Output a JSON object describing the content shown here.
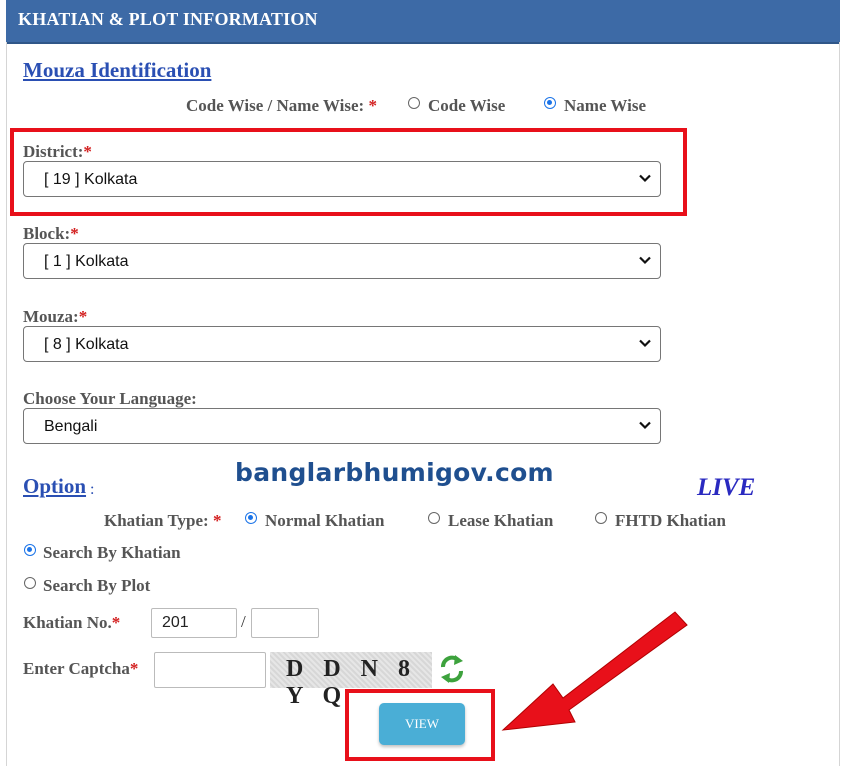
{
  "header": {
    "title": "KHATIAN & PLOT INFORMATION"
  },
  "mouza_section": {
    "title": "Mouza Identification",
    "mode_label": "Code Wise / Name Wise:",
    "required_mark": "*",
    "mode_options": [
      {
        "label": "Code Wise",
        "selected": false
      },
      {
        "label": "Name Wise",
        "selected": true
      }
    ]
  },
  "district": {
    "label": "District:",
    "required_mark": "*",
    "value": "[ 19 ] Kolkata"
  },
  "block": {
    "label": "Block:",
    "required_mark": "*",
    "value": "[ 1 ] Kolkata"
  },
  "mouza": {
    "label": "Mouza:",
    "required_mark": "*",
    "value": "[ 8 ] Kolkata"
  },
  "language": {
    "label": "Choose Your Language:",
    "value": "Bengali"
  },
  "option_section": {
    "title": "Option",
    "colon": ":",
    "khatian_type_label": "Khatian Type:",
    "required_mark": "*",
    "khatian_types": [
      {
        "label": "Normal Khatian",
        "selected": true
      },
      {
        "label": "Lease Khatian",
        "selected": false
      },
      {
        "label": "FHTD Khatian",
        "selected": false
      }
    ],
    "search_modes": [
      {
        "label": "Search By Khatian",
        "selected": true
      },
      {
        "label": "Search By Plot",
        "selected": false
      }
    ]
  },
  "khatian_no": {
    "label": "Khatian No.",
    "required_mark": "*",
    "value": "201",
    "separator": "/",
    "value2": ""
  },
  "captcha": {
    "label": "Enter Captcha",
    "required_mark": "*",
    "value": "",
    "code": "D D N 8 Y Q"
  },
  "view_button": {
    "label": "VIEW"
  },
  "overlay": {
    "watermark": "banglarbhumigov.com",
    "live": "LIVE"
  },
  "colors": {
    "header": "#3d6aa6",
    "highlight": "#e8101a",
    "button": "#4aaed6",
    "link": "#2a4fb3"
  }
}
